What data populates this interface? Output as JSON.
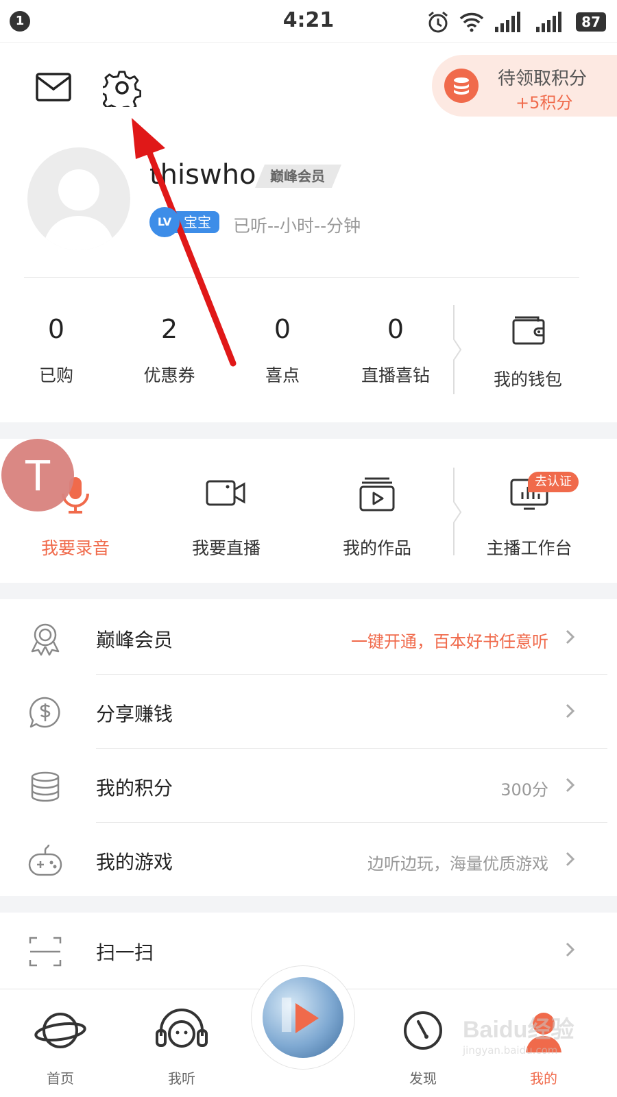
{
  "status_bar": {
    "notification_count": "1",
    "time": "4:21",
    "battery": "87"
  },
  "header": {
    "points_title": "待领取积分",
    "points_reward": "+5积分"
  },
  "profile": {
    "username": "thiswho",
    "vip_badge": "巅峰会员",
    "level_prefix": "LV",
    "level_label": "宝宝",
    "listen_time": "已听--小时--分钟"
  },
  "stats": [
    {
      "value": "0",
      "label": "已购"
    },
    {
      "value": "2",
      "label": "优惠券"
    },
    {
      "value": "0",
      "label": "喜点"
    },
    {
      "value": "0",
      "label": "直播喜钻"
    }
  ],
  "wallet": {
    "label": "我的钱包"
  },
  "overlay_avatar": {
    "letter": "T"
  },
  "tools": [
    {
      "label": "我要录音",
      "icon": "microphone-icon"
    },
    {
      "label": "我要直播",
      "icon": "video-camera-icon"
    },
    {
      "label": "我的作品",
      "icon": "play-stack-icon"
    },
    {
      "label": "主播工作台",
      "icon": "dashboard-icon",
      "badge": "去认证"
    }
  ],
  "menu": [
    {
      "label": "巅峰会员",
      "value": "一键开通，百本好书任意听",
      "icon": "medal-icon"
    },
    {
      "label": "分享赚钱",
      "value": "",
      "icon": "dollar-bubble-icon"
    },
    {
      "label": "我的积分",
      "value": "300分",
      "icon": "coin-stack-icon"
    },
    {
      "label": "我的游戏",
      "value": "边听边玩，海量优质游戏",
      "icon": "gamepad-icon"
    },
    {
      "label": "扫一扫",
      "value": "",
      "icon": "scan-icon"
    }
  ],
  "bottom_nav": [
    {
      "label": "首页",
      "icon": "planet-icon"
    },
    {
      "label": "我听",
      "icon": "headphones-icon"
    },
    {
      "label": "发现",
      "icon": "compass-icon"
    },
    {
      "label": "我的",
      "icon": "profile-icon"
    }
  ],
  "watermark": {
    "logo": "Baidu经验",
    "url": "jingyan.baidu.com"
  },
  "colors": {
    "accent": "#f06a4b",
    "level_blue": "#3d8de8",
    "annotation_red": "#e01818"
  }
}
